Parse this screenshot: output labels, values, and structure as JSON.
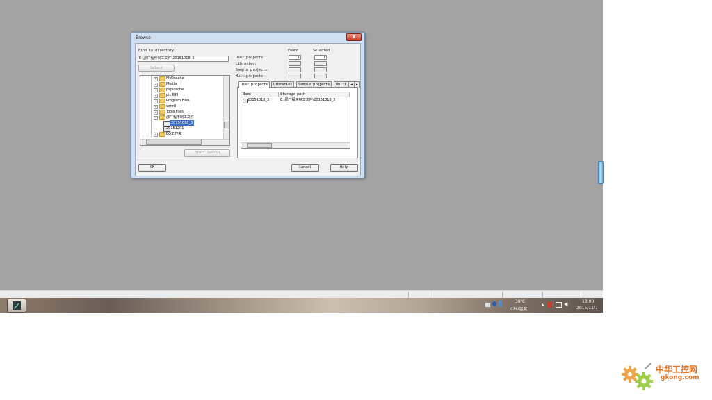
{
  "dialog": {
    "title": "Browse",
    "close_label": "x",
    "find_label": "Find in directory:",
    "path_value": "E:\\邵厂程序制工文件\\20151018_3",
    "select_button": "Select",
    "found_label": "Found",
    "selected_label": "Selected",
    "rows": [
      {
        "label": "User projects:",
        "found": "1",
        "selected": "1"
      },
      {
        "label": "Libraries:",
        "found": "",
        "selected": ""
      },
      {
        "label": "Sample projects:",
        "found": "",
        "selected": ""
      },
      {
        "label": "Multiprojects:",
        "found": "",
        "selected": ""
      }
    ],
    "tree": [
      {
        "exp": "+",
        "text": "MsOcache",
        "type": "folder"
      },
      {
        "exp": "+",
        "text": "Media",
        "type": "folder"
      },
      {
        "exp": "+",
        "text": "pspicache",
        "type": "folder"
      },
      {
        "exp": "+",
        "text": "plc资料",
        "type": "folder"
      },
      {
        "exp": "+",
        "text": "Program Files",
        "type": "folder"
      },
      {
        "exp": "+",
        "text": "wmr8",
        "type": "folder"
      },
      {
        "exp": "+",
        "text": "Tools Files",
        "type": "folder"
      },
      {
        "exp": "-",
        "text": "邵厂程序制工文件",
        "type": "folder"
      },
      {
        "exp": "",
        "text": "20151018_3",
        "type": "project",
        "selected": true
      },
      {
        "exp": "",
        "text": "20151201",
        "type": "project"
      },
      {
        "exp": "+",
        "text": "EQ工作夹",
        "type": "folder"
      }
    ],
    "start_search": "Start Search",
    "tabs": [
      "User projects",
      "Libraries",
      "Sample projects",
      "Multi..."
    ],
    "list_headers": [
      "Name",
      "Storage path"
    ],
    "list_rows": [
      {
        "name": "20151018_3",
        "path": "E:\\邵厂程序制工文件\\20151018_3"
      }
    ],
    "ok": "OK",
    "cancel": "Cancel",
    "help": "Help"
  },
  "taskbar": {
    "temp": "38℃",
    "cpu": "CPU温度",
    "time": "13:00",
    "date": "2015/11/7"
  },
  "watermark": {
    "text_cn": "中华工控网",
    "text_en": "gkong.com",
    "color": "#e8731f"
  }
}
